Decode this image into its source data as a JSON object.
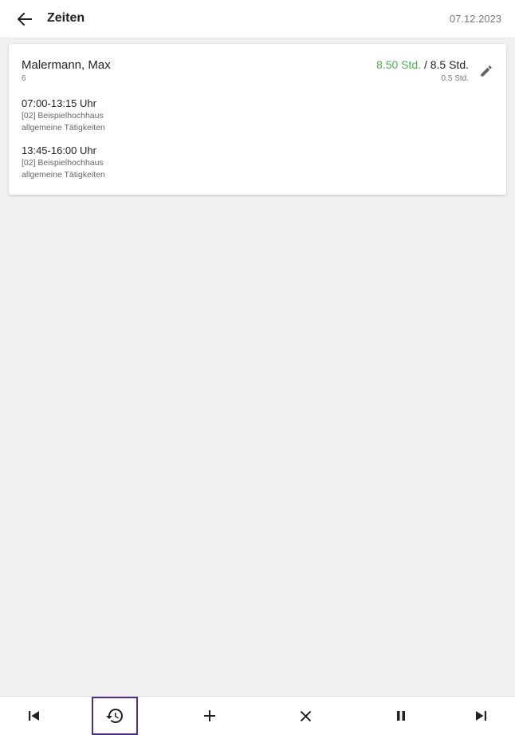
{
  "header": {
    "title": "Zeiten",
    "date": "07.12.2023",
    "back_icon": "arrow-back-icon"
  },
  "employee": {
    "name": "Malermann, Max",
    "number": "6",
    "hours_actual": "8.50 Std.",
    "hours_separator": " / ",
    "hours_target": "8.5 Std.",
    "hours_break": "0.5 Std.",
    "edit_icon": "pencil-icon",
    "colors": {
      "actual": "#4caf50"
    }
  },
  "entries": [
    {
      "time": "07:00-13:15 Uhr",
      "project": "[02] Beispielhochhaus",
      "activity": "allgemeine Tätigkeiten"
    },
    {
      "time": "13:45-16:00 Uhr",
      "project": "[02] Beispielhochhaus",
      "activity": "allgemeine Tätigkeiten"
    }
  ],
  "bottom_nav": {
    "items": [
      {
        "icon": "skip-previous-icon"
      },
      {
        "icon": "history-icon",
        "selected": true
      },
      {
        "icon": "add-icon"
      },
      {
        "icon": "close-icon"
      },
      {
        "icon": "pause-icon"
      },
      {
        "icon": "skip-next-icon"
      }
    ],
    "highlight_color": "#4b2c91"
  }
}
